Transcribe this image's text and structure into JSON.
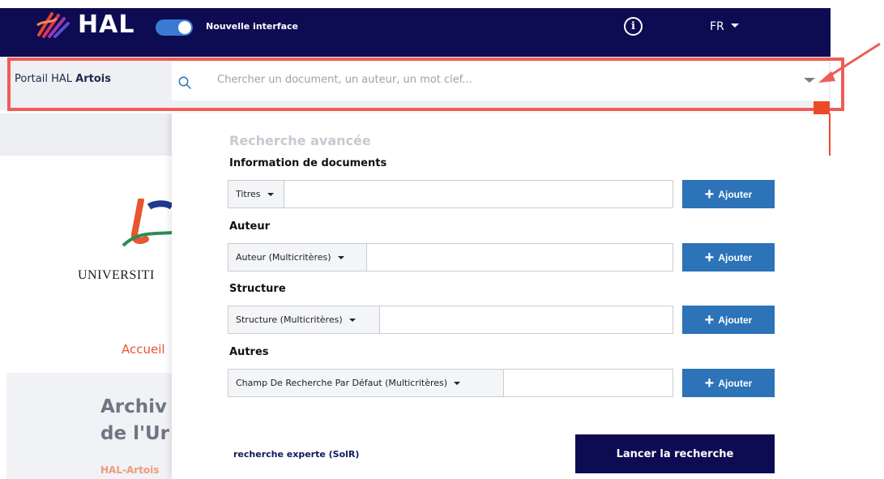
{
  "header": {
    "logo_text": "HAL",
    "toggle_label": "Nouvelle interface",
    "info_icon": "info-icon",
    "language": "FR"
  },
  "search": {
    "portal_prefix": "Portail HAL ",
    "portal_name": "Artois",
    "placeholder": "Chercher un document, un auteur, un mot clef..."
  },
  "background": {
    "university_text": "UNIVERSITI",
    "accueil": "Accueil",
    "archive_line1": "Archiv",
    "archive_line2": "de l'Ur",
    "hal_artois": "HAL-Artois"
  },
  "advanced": {
    "title": "Recherche avancée",
    "sections": [
      {
        "label": "Information de documents",
        "select": "Titres",
        "button": "Ajouter"
      },
      {
        "label": "Auteur",
        "select": "Auteur (Multicritères)",
        "button": "Ajouter"
      },
      {
        "label": "Structure",
        "select": "Structure (Multicritères)",
        "button": "Ajouter"
      },
      {
        "label": "Autres",
        "select": "Champ De Recherche Par Défaut (Multicritères)",
        "button": "Ajouter"
      }
    ],
    "expert_link": "recherche experte (SolR)",
    "launch_button": "Lancer la recherche"
  },
  "colors": {
    "navbar": "#0d0b52",
    "accent_blue": "#2c73b8",
    "annotation_red": "#ee5d57"
  }
}
